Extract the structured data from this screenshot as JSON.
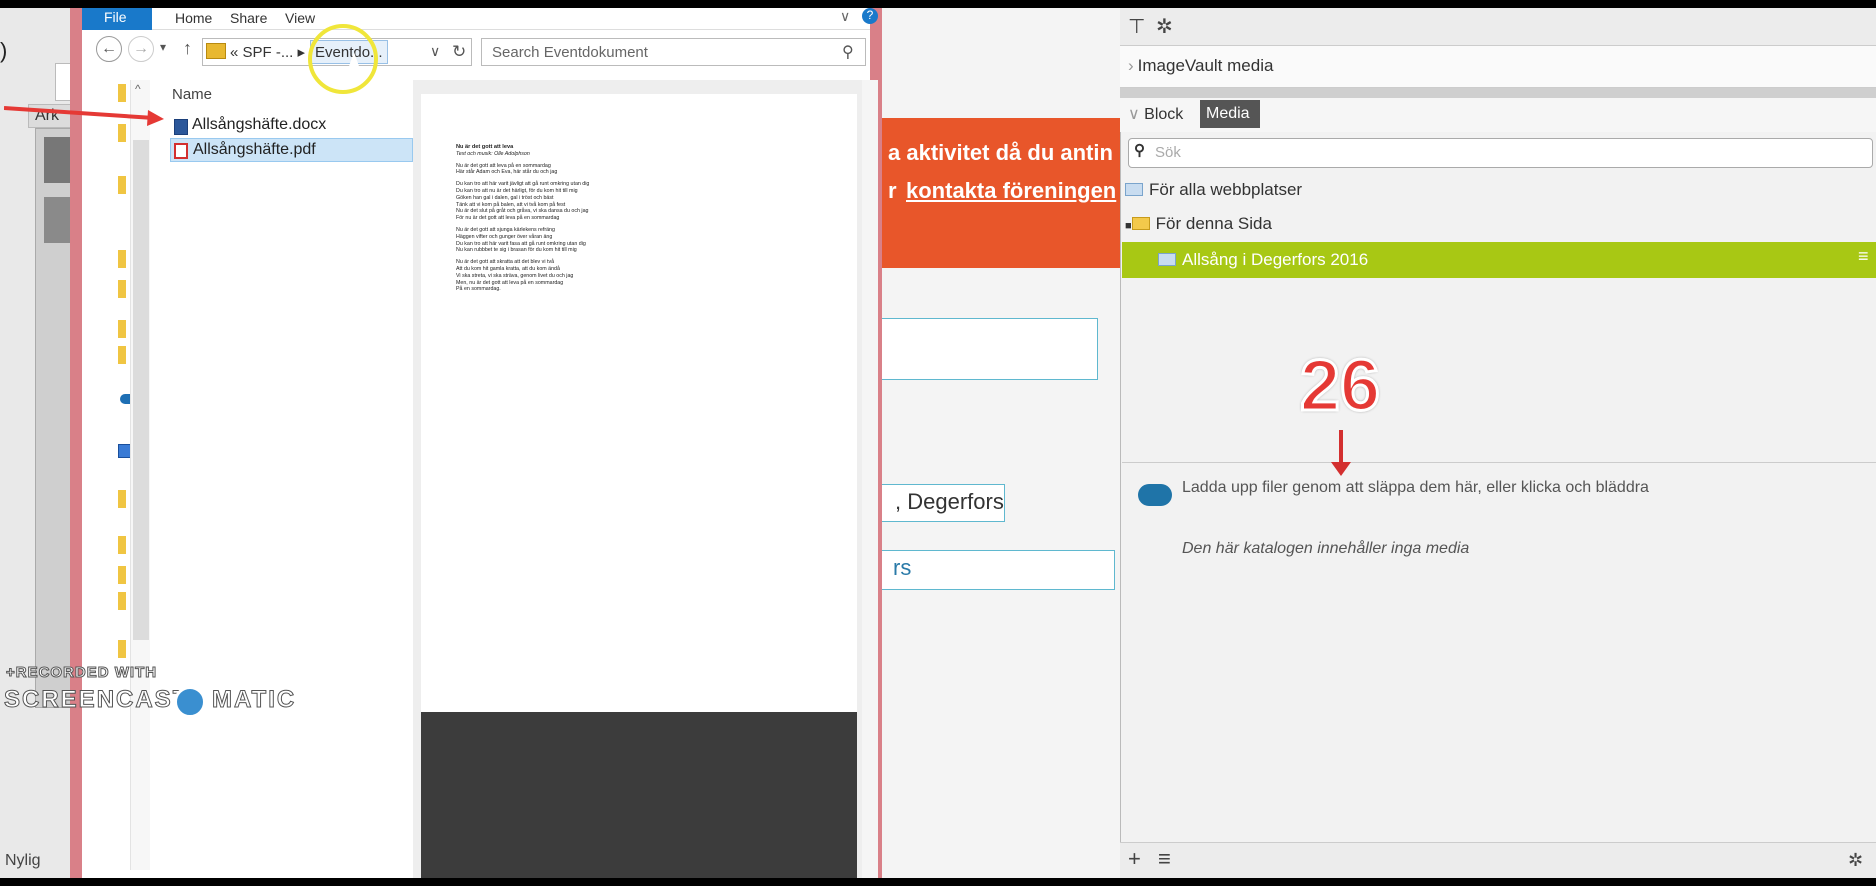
{
  "explorer": {
    "ribbon_tabs": [
      "File",
      "Home",
      "Share",
      "View"
    ],
    "breadcrumb_prefix": "« SPF -... ▸",
    "current_folder": "Eventdo...",
    "search_placeholder": "Search Eventdokument",
    "column_name": "Name",
    "files": [
      "Allsångshäfte.docx",
      "Allsångshäfte.pdf"
    ]
  },
  "preview": {
    "title": "Nu är det gott att leva",
    "subtitle": "Text och musik: Olle Adolphson",
    "paragraphs": [
      [
        "Nu är det gott att leva på en sommardag",
        "Här står Adam och Eva, här står du och jag"
      ],
      [
        "Du kan tro att här varit jävligt att gå runt omkring utan dig",
        "Du kan tro att nu är det härligt, för du kom hit till mig",
        "Göken han gal i dalen, gal i tröst och bäst",
        "Tänk att vi kom på balen, att vi två kom på fest",
        "Nu är det slut på gråt och gråva, vi ska dansa du och jag",
        "För nu är det gott att leva på en sommardag"
      ],
      [
        "Nu är det gott att sjunga kärlekens refräng",
        "Häggen vifter och gunger över våran äng",
        "Du kan tro att här varit fasa att gå runt omkring utan dig",
        "Nu kan rubbbet te sig i brasan för du kom hit till mig"
      ],
      [
        "Nu är det gott att skratta att det blev vi två",
        "Att du kom hit gamla kratta, att du kom ändå",
        "Vi ska streta, vi ska sträva, genom livet du och jag",
        "Men, nu är det gott att leva på en sommardag",
        "På en sommardag."
      ]
    ]
  },
  "back_window": {
    "tab_label": "Ark",
    "nav_item": "Nylig"
  },
  "webpage": {
    "orange_line1": "a aktivitet då du antin",
    "orange_line2_prefix": "r",
    "orange_line2_link": "kontakta föreningen",
    "city_box": ", Degerfors",
    "box3_text": "rs"
  },
  "right_panel": {
    "imagevault_label": "ImageVault media",
    "tab_block": "Block",
    "tab_media": "Media",
    "search_placeholder": "Sök",
    "tree": {
      "item1": "För alla webbplatser",
      "item2": "För denna Sida",
      "item3": "Allsång i Degerfors 2016"
    },
    "upload_text": "Ladda upp filer genom att släppa dem här, eller klicka och bläddra",
    "empty_text": "Den här katalogen innehåller inga media"
  },
  "annotation": {
    "step_number": "26"
  },
  "watermark": {
    "line1": "+RECORDED WITH",
    "line2a": "SCREENCAST",
    "line2b": "MATIC"
  },
  "colors": {
    "accent_blue": "#1979ca",
    "orange": "#e8562a",
    "lime_selected": "#a8c814",
    "annotation_red": "#e53935"
  }
}
